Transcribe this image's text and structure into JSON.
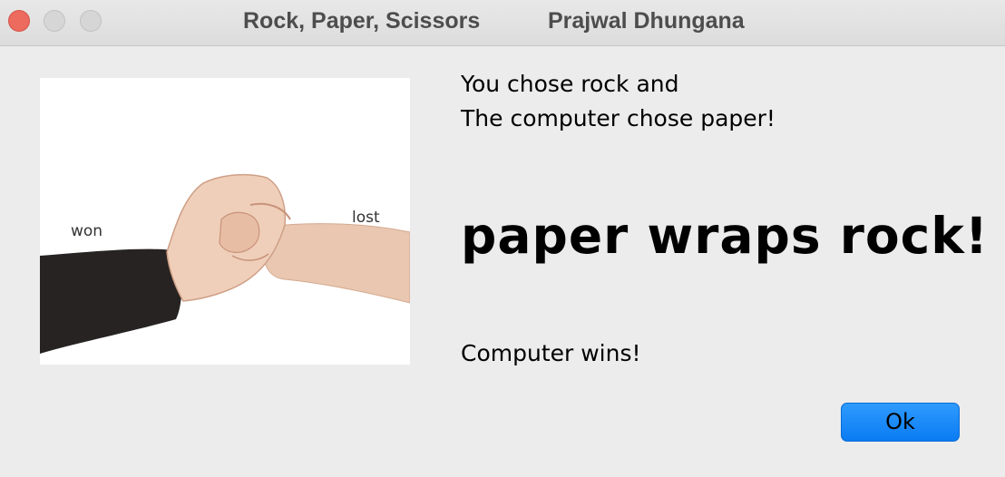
{
  "window": {
    "title": "Rock, Paper, Scissors",
    "author": "Prajwal Dhungana"
  },
  "illustration": {
    "left_label": "won",
    "right_label": "lost"
  },
  "message": {
    "line1": "You chose rock and",
    "line2": "The computer chose paper!",
    "headline": "paper wraps rock!",
    "result": "Computer wins!"
  },
  "buttons": {
    "ok_label": "Ok"
  },
  "colors": {
    "close": "#ed6a5e",
    "accent": "#0a7bf2",
    "window_bg": "#ececec"
  }
}
